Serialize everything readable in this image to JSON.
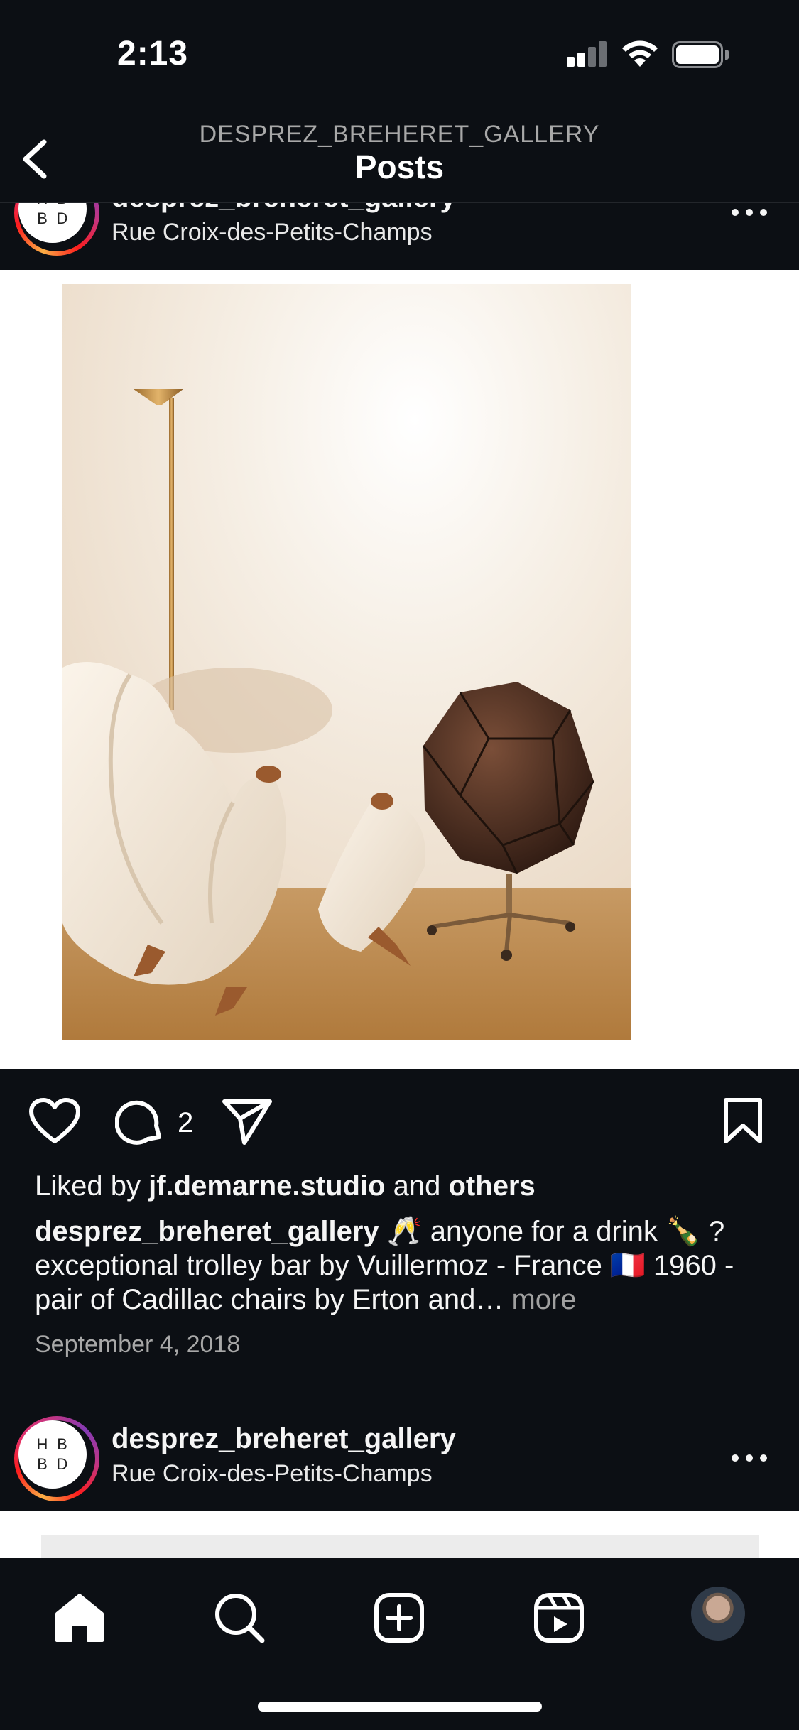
{
  "status_bar": {
    "time": "2:13"
  },
  "nav": {
    "subtitle": "DESPREZ_BREHERET_GALLERY",
    "title": "Posts"
  },
  "post": {
    "username": "desprez_breheret_gallery",
    "location": "Rue Croix-des-Petits-Champs",
    "avatar_letters": [
      "H",
      "B",
      "B",
      "D"
    ],
    "comment_count": "2",
    "liked_by_prefix": "Liked by",
    "liked_by_user": "jf.demarne.studio",
    "liked_by_and": "and",
    "liked_by_others": "others",
    "caption_text": " 🥂 anyone for a drink 🍾 ? exceptional trolley bar by Vuillermoz - France 🇫🇷 1960 - pair of Cadillac chairs by Erton and… ",
    "caption_more": "more",
    "date": "September 4, 2018"
  },
  "next_post": {
    "username": "desprez_breheret_gallery",
    "location": "Rue Croix-des-Petits-Champs"
  },
  "icons": {
    "back": "chevron-left-icon",
    "like": "heart-icon",
    "comment": "comment-icon",
    "share": "paper-plane-icon",
    "save": "bookmark-icon",
    "home": "home-icon",
    "search": "search-icon",
    "create": "plus-square-icon",
    "reels": "reels-icon",
    "profile": "profile-avatar"
  },
  "colors": {
    "background": "#0c0f14",
    "text_primary": "#f5f5f5",
    "text_secondary": "#a8a8a8",
    "story_ring_start": "#fcaf45",
    "story_ring_end": "#c13584"
  }
}
